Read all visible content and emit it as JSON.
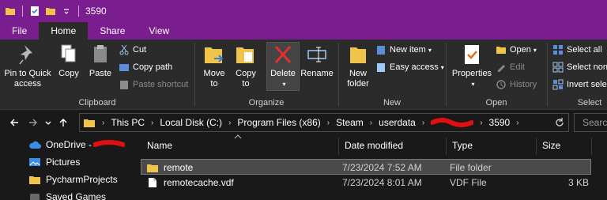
{
  "title": {
    "folder_name": "3590"
  },
  "ribbon_tabs": [
    "File",
    "Home",
    "Share",
    "View"
  ],
  "ribbon": {
    "clipboard": {
      "label": "Clipboard",
      "pin_label_1": "Pin to Quick",
      "pin_label_2": "access",
      "copy": "Copy",
      "paste": "Paste",
      "cut": "Cut",
      "copy_path": "Copy path",
      "paste_shortcut": "Paste shortcut"
    },
    "organize": {
      "label": "Organize",
      "move_to_1": "Move",
      "move_to_2": "to",
      "copy_to_1": "Copy",
      "copy_to_2": "to",
      "delete": "Delete",
      "rename": "Rename"
    },
    "new": {
      "label": "New",
      "new_folder_1": "New",
      "new_folder_2": "folder",
      "new_item": "New item",
      "easy_access": "Easy access"
    },
    "open": {
      "label": "Open",
      "properties": "Properties",
      "open": "Open",
      "edit": "Edit",
      "history": "History"
    },
    "select": {
      "label": "Select",
      "select_all": "Select all",
      "select_none": "Select none",
      "invert_selection": "Invert selection"
    }
  },
  "address": {
    "crumbs": [
      "This PC",
      "Local Disk (C:)",
      "Program Files (x86)",
      "Steam",
      "userdata",
      "3590"
    ],
    "search_placeholder": "Search"
  },
  "nav_pane": {
    "items": [
      "OneDrive -",
      "Pictures",
      "PycharmProjects",
      "Saved Games"
    ]
  },
  "columns": [
    "Name",
    "Date modified",
    "Type",
    "Size"
  ],
  "files": [
    {
      "name": "remote",
      "date": "7/23/2024 7:52 AM",
      "type": "File folder",
      "size": ""
    },
    {
      "name": "remotecache.vdf",
      "date": "7/23/2024 8:01 AM",
      "type": "VDF File",
      "size": "3 KB"
    }
  ],
  "colors": {
    "titlebar": "#7a1d8e",
    "ribbon_bg": "#2b2b2b",
    "window_bg": "#191919",
    "selected_row": "#4a4a4a",
    "folder_yellow": "#f0c44a",
    "redaction": "#e01010"
  }
}
